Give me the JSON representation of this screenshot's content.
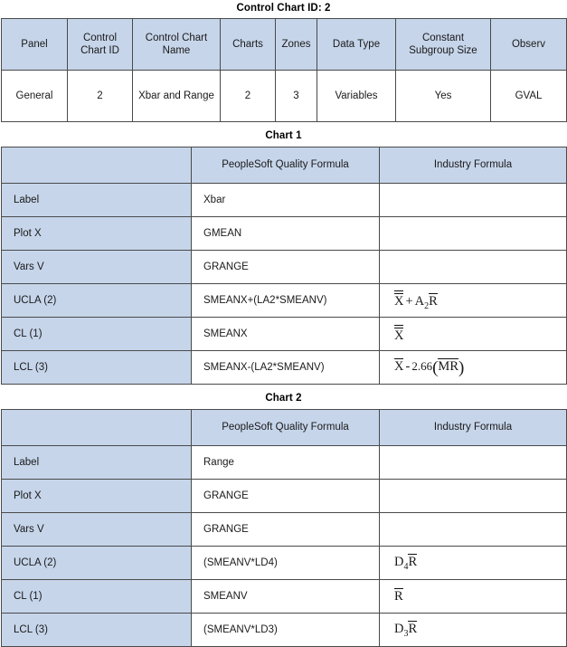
{
  "titles": {
    "main": "Control Chart ID: 2",
    "chart1": "Chart 1",
    "chart2": "Chart 2"
  },
  "colors": {
    "header_fill": "#c6d5ea",
    "border": "#4a4a4a",
    "cell_fill": "#ffffff",
    "text": "#1a1a1a"
  },
  "summary_table": {
    "columns": [
      "Panel",
      "Control Chart ID",
      "Control Chart Name",
      "Charts",
      "Zones",
      "Data Type",
      "Constant Subgroup Size",
      "Observ"
    ],
    "rows": [
      {
        "panel": "General",
        "control_chart_id": "2",
        "control_chart_name": "Xbar and Range",
        "charts": "2",
        "zones": "3",
        "data_type": "Variables",
        "constant_subgroup_size": "Yes",
        "observ": "GVAL"
      }
    ]
  },
  "chart1_table": {
    "columns": [
      "",
      "PeopleSoft Quality Formula",
      "Industry Formula"
    ],
    "rows": [
      {
        "label": "Label",
        "peoplesoft": "Xbar",
        "industry_type": "none"
      },
      {
        "label": "Plot X",
        "peoplesoft": "GMEAN",
        "industry_type": "none"
      },
      {
        "label": "Vars V",
        "peoplesoft": "GRANGE",
        "industry_type": "none"
      },
      {
        "label": "UCLA (2)",
        "peoplesoft": "SMEANX+(LA2*SMEANV)",
        "industry_type": "xdbar_plus_a2rbar",
        "industry_text": "X̿ + A₂R̄"
      },
      {
        "label": "CL (1)",
        "peoplesoft": "SMEANX",
        "industry_type": "xdbar",
        "industry_text": "X̿"
      },
      {
        "label": "LCL (3)",
        "peoplesoft": "SMEANX-(LA2*SMEANV)",
        "industry_type": "xbar_minus_266mr",
        "industry_text": "X̄ - 2.66(M̄R̄)"
      }
    ]
  },
  "chart2_table": {
    "columns": [
      "",
      "PeopleSoft Quality Formula",
      "Industry Formula"
    ],
    "rows": [
      {
        "label": "Label",
        "peoplesoft": "Range",
        "industry_type": "none"
      },
      {
        "label": "Plot X",
        "peoplesoft": "GRANGE",
        "industry_type": "none"
      },
      {
        "label": "Vars V",
        "peoplesoft": "GRANGE",
        "industry_type": "none"
      },
      {
        "label": "UCLA (2)",
        "peoplesoft": "(SMEANV*LD4)",
        "industry_type": "d4rbar",
        "industry_text": "D₄R̄"
      },
      {
        "label": "CL (1)",
        "peoplesoft": "SMEANV",
        "industry_type": "rbar",
        "industry_text": "R̄"
      },
      {
        "label": "LCL (3)",
        "peoplesoft": "(SMEANV*LD3)",
        "industry_type": "d3rbar",
        "industry_text": "D₃R̄"
      }
    ]
  },
  "math_parts": {
    "x": "X",
    "r": "R",
    "m": "M",
    "d": "D",
    "a": "A",
    "sub_2": "2",
    "sub_3": "3",
    "sub_4": "4",
    "plus": "+",
    "minus": "-",
    "const_266": "2.66",
    "paren_open": "(",
    "paren_close": ")"
  }
}
